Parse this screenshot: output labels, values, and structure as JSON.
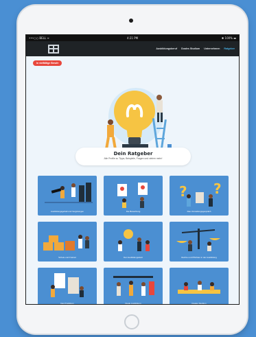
{
  "statusbar": {
    "carrier": "•••○○ BELL ᯤ",
    "time": "4:21 PM",
    "battery": "✱ 100% ▬"
  },
  "nav": {
    "links": [
      "Ausbildungsberuf",
      "Duales Studium",
      "Unternehmen",
      "Ratgeber"
    ],
    "active_index": 3
  },
  "badge": "In vielfältige Berufe",
  "header": {
    "title": "Dein Ratgeber",
    "subtitle": "Alle Profile zu Tipps, Beispiele, Fragen und vielem mehr!"
  },
  "tiles": [
    {
      "label": "Ausbildungsgehalt und Vergütungen",
      "icon": "telescope-people-illustration"
    },
    {
      "label": "Die Bewerbung",
      "icon": "application-papers-illustration"
    },
    {
      "label": "Das Vorstellungsgespräch",
      "icon": "question-marks-illustration"
    },
    {
      "label": "Schule und Freizeit",
      "icon": "boxes-people-illustration"
    },
    {
      "label": "Der Ausbildungsstart",
      "icon": "start-team-illustration"
    },
    {
      "label": "Rechte und Pflichten in der Ausbildung",
      "icon": "scales-illustration"
    },
    {
      "label": "Das Praktikum",
      "icon": "internship-illustration"
    },
    {
      "label": "Duale Ausbildung",
      "icon": "dual-training-illustration"
    },
    {
      "label": "Duales Studium",
      "icon": "dual-study-illustration"
    }
  ],
  "colors": {
    "accent": "#49b3e8",
    "tile": "#4b8fd2",
    "badge": "#e8473c",
    "bulb": "#f6c443",
    "background": "#4a8fd3"
  }
}
